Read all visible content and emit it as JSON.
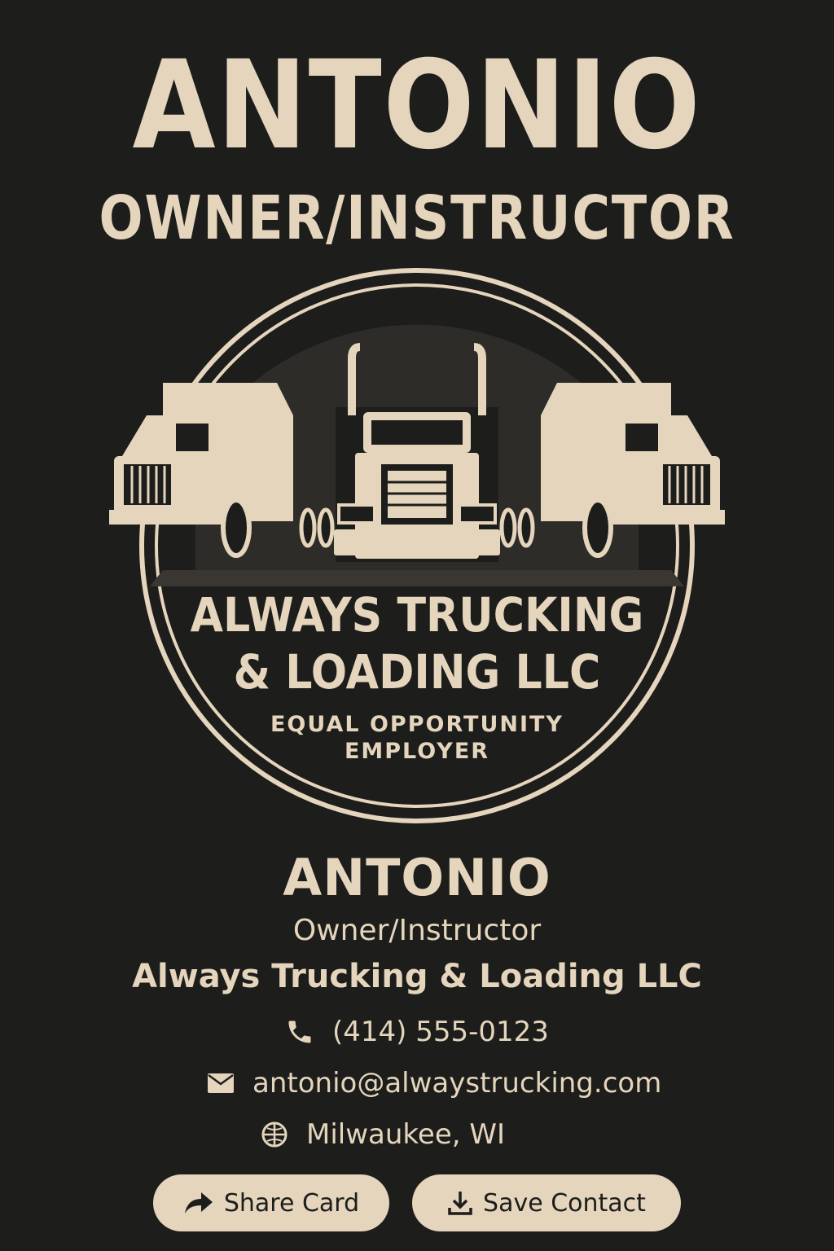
{
  "header": {
    "name": "ANTONIO",
    "title": "OWNER/INSTRUCTOR"
  },
  "logo": {
    "company_line1": "ALWAYS TRUCKING",
    "company_line2": "& LOADING LLC",
    "tagline_line1": "EQUAL OPPORTUNITY",
    "tagline_line2": "EMPLOYER"
  },
  "card": {
    "name": "ANTONIO",
    "role": "Owner/Instructor",
    "company": "Always Trucking & Loading LLC"
  },
  "contact": {
    "phone": "(414) 555-0123",
    "email": "antonio@alwaystrucking.com",
    "location": "Milwaukee, WI"
  },
  "actions": {
    "share_label": "Share Card",
    "save_label": "Save Contact"
  },
  "icons": {
    "phone": "phone-icon",
    "email": "mail-icon",
    "location": "globe-icon",
    "share": "share-arrow-icon",
    "save": "download-icon"
  },
  "colors": {
    "background": "#1d1d1c",
    "accent": "#e4d5bc",
    "button_text": "#1d1d1c"
  }
}
